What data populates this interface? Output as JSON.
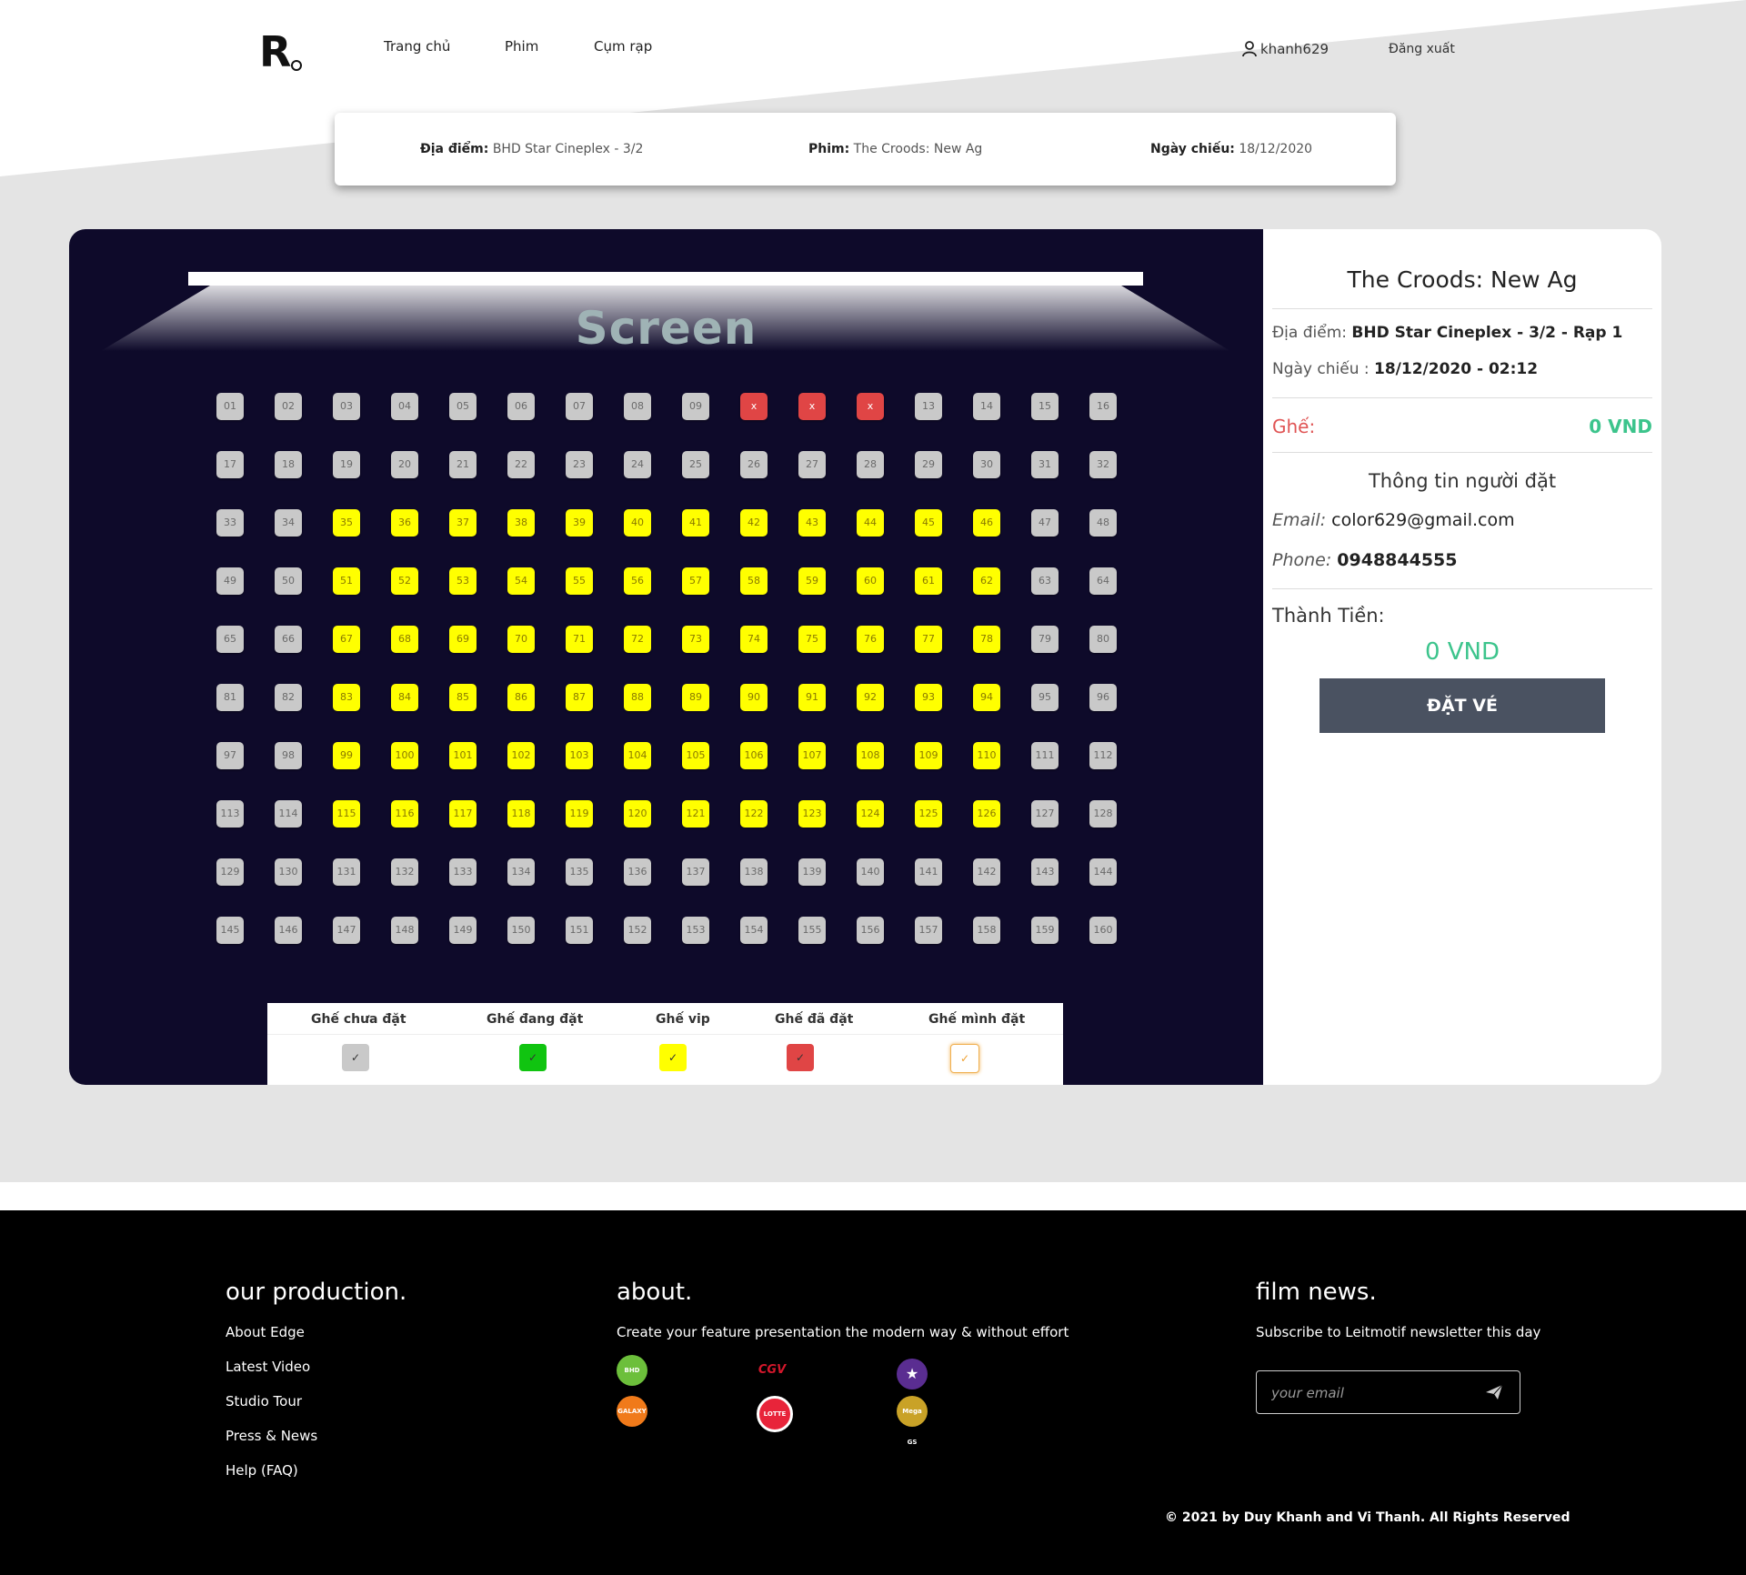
{
  "header": {
    "logo": "R",
    "nav": [
      "Trang chủ",
      "Phim",
      "Cụm rạp"
    ],
    "username": "khanh629",
    "logout_label": "Đăng xuất"
  },
  "info_bar": {
    "location_label": "Địa điểm:",
    "location_value": "BHD Star Cineplex - 3/2",
    "movie_label": "Phim:",
    "movie_value": "The Croods: New Ag",
    "date_label": "Ngày chiếu:",
    "date_value": "18/12/2020"
  },
  "screen_label": "Screen",
  "seats": {
    "taken": [
      10,
      11,
      12
    ],
    "vip": [
      35,
      36,
      37,
      38,
      39,
      40,
      41,
      42,
      43,
      44,
      45,
      46,
      51,
      52,
      53,
      54,
      55,
      56,
      57,
      58,
      59,
      60,
      61,
      62,
      67,
      68,
      69,
      70,
      71,
      72,
      73,
      74,
      75,
      76,
      77,
      78,
      83,
      84,
      85,
      86,
      87,
      88,
      89,
      90,
      91,
      92,
      93,
      94,
      99,
      100,
      101,
      102,
      103,
      104,
      105,
      106,
      107,
      108,
      109,
      110,
      115,
      116,
      117,
      118,
      119,
      120,
      121,
      122,
      123,
      124,
      125,
      126
    ],
    "taken_mark": "x",
    "colors": {
      "normal": "#c9c9c9",
      "vip": "#ffff00",
      "taken": "#e04545"
    }
  },
  "legend": [
    {
      "label": "Ghế chưa đặt",
      "mark": "✓",
      "color": "#c9c9c9"
    },
    {
      "label": "Ghế đang đặt",
      "mark": "✓",
      "color": "#10c410"
    },
    {
      "label": "Ghế vip",
      "mark": "✓",
      "color": "#ffff00"
    },
    {
      "label": "Ghế đã đặt",
      "mark": "✓",
      "color": "#e04545"
    },
    {
      "label": "Ghế mình đặt",
      "mark": "✓",
      "color": "#ffffff"
    }
  ],
  "summary": {
    "movie_title": "The Croods: New Ag",
    "location_label": "Địa điểm: ",
    "location_value": "BHD Star Cineplex - 3/2 - Rạp 1",
    "date_label": "Ngày chiếu : ",
    "date_value": "18/12/2020 - 02:12",
    "seat_label": "Ghế:",
    "seat_price": "0 VND",
    "booker_title": "Thông tin người đặt",
    "email_label": "Email: ",
    "email_value": "color629@gmail.com",
    "phone_label": "Phone: ",
    "phone_value": "0948844555",
    "total_label": "Thành Tiền:",
    "total_value": "0 VND",
    "book_button": "ĐẶT VÉ"
  },
  "footer": {
    "production_title": "our production.",
    "production_links": [
      "About Edge",
      "Latest Video",
      "Studio Tour",
      "Press & News",
      "Help (FAQ)"
    ],
    "about_title": "about.",
    "about_text": "Create your feature presentation the modern way & without effort",
    "cinema_logos": [
      {
        "name": "BHD",
        "color": "#6cbf3b"
      },
      {
        "name": "CGV",
        "color": "#d3172b"
      },
      {
        "name": "★",
        "color": "#5a2d91"
      },
      {
        "name": "GALAXY",
        "color": "#f07a1a"
      },
      {
        "name": "LOTTE",
        "color": "#e8243a"
      },
      {
        "name": "Mega GS",
        "color": "#c9a227"
      }
    ],
    "news_title": "film news.",
    "news_text": "Subscribe to Leitmotif newsletter this day",
    "email_placeholder": "your email",
    "copyright": "© 2021 by Duy Khanh and Vi Thanh. All Rights Reserved"
  }
}
